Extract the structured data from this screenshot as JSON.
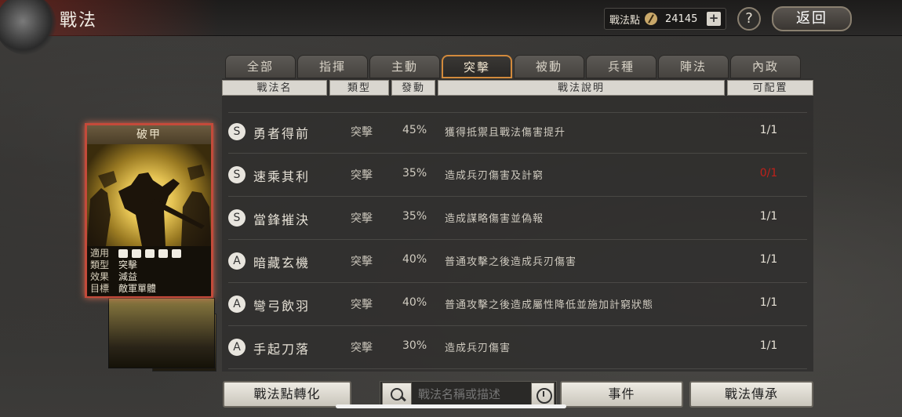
{
  "header": {
    "title": "戰法",
    "points_label": "戰法點",
    "points_value": "24145",
    "plus_label": "+",
    "help_label": "?",
    "back_label": "返回"
  },
  "tabs": [
    {
      "label": "全部"
    },
    {
      "label": "指揮"
    },
    {
      "label": "主動"
    },
    {
      "label": "突擊",
      "active": true
    },
    {
      "label": "被動"
    },
    {
      "label": "兵種"
    },
    {
      "label": "陣法"
    },
    {
      "label": "內政"
    }
  ],
  "columns": {
    "name": "戰法名",
    "type": "類型",
    "rate": "發動",
    "desc": "戰法說明",
    "slot": "可配置"
  },
  "rows": [
    {
      "grade": "S",
      "name": "勇者得前",
      "type": "突擊",
      "rate": "45%",
      "desc": "獲得抵禦且戰法傷害提升",
      "slot": "1/1",
      "slot_color": "#e6e1d6"
    },
    {
      "grade": "S",
      "name": "速乘其利",
      "type": "突擊",
      "rate": "35%",
      "desc": "造成兵刃傷害及計窮",
      "slot": "0/1",
      "slot_color": "#c0201a"
    },
    {
      "grade": "S",
      "name": "當鋒摧決",
      "type": "突擊",
      "rate": "35%",
      "desc": "造成謀略傷害並偽報",
      "slot": "1/1",
      "slot_color": "#e6e1d6"
    },
    {
      "grade": "A",
      "name": "暗藏玄機",
      "type": "突擊",
      "rate": "40%",
      "desc": "普通攻擊之後造成兵刃傷害",
      "slot": "1/1",
      "slot_color": "#e6e1d6"
    },
    {
      "grade": "A",
      "name": "彎弓飲羽",
      "type": "突擊",
      "rate": "40%",
      "desc": "普通攻擊之後造成屬性降低並施加計窮狀態",
      "slot": "1/1",
      "slot_color": "#e6e1d6"
    },
    {
      "grade": "A",
      "name": "手起刀落",
      "type": "突擊",
      "rate": "30%",
      "desc": "造成兵刃傷害",
      "slot": "1/1",
      "slot_color": "#e6e1d6"
    }
  ],
  "card": {
    "title": "破甲",
    "apply_key": "適用",
    "type_key": "類型",
    "type_val": "突擊",
    "effect_key": "效果",
    "effect_val": "減益",
    "target_key": "目標",
    "target_val": "敵軍單體"
  },
  "bottom": {
    "convert_label": "戰法點轉化",
    "search_placeholder": "戰法名稱或描述",
    "event_label": "事件",
    "inherit_label": "戰法傳承"
  }
}
